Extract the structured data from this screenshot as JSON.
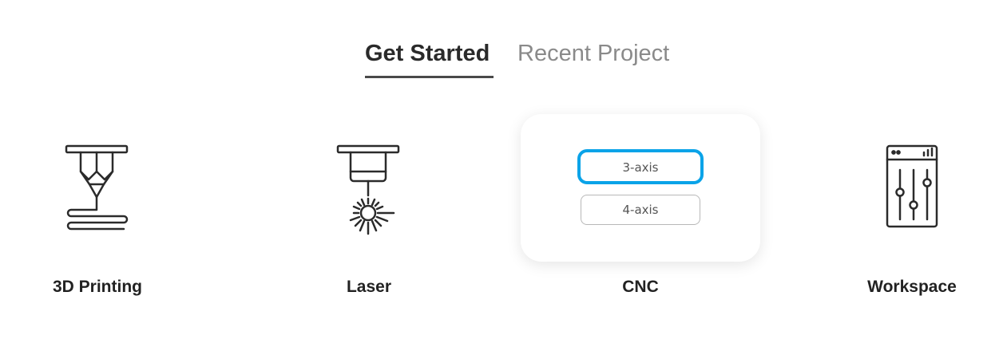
{
  "tabs": {
    "get_started": "Get Started",
    "recent_project": "Recent Project"
  },
  "cards": {
    "printing": {
      "label": "3D Printing",
      "icon": "3d-printer-nozzle-icon"
    },
    "laser": {
      "label": "Laser",
      "icon": "laser-head-icon"
    },
    "cnc": {
      "label": "CNC",
      "options": [
        "3-axis",
        "4-axis"
      ],
      "selected": "3-axis"
    },
    "workspace": {
      "label": "Workspace",
      "icon": "workspace-sliders-icon"
    }
  },
  "colors": {
    "selected_border": "#0aa3e8",
    "text_dark": "#222222",
    "text_muted": "#8a8a8a"
  }
}
